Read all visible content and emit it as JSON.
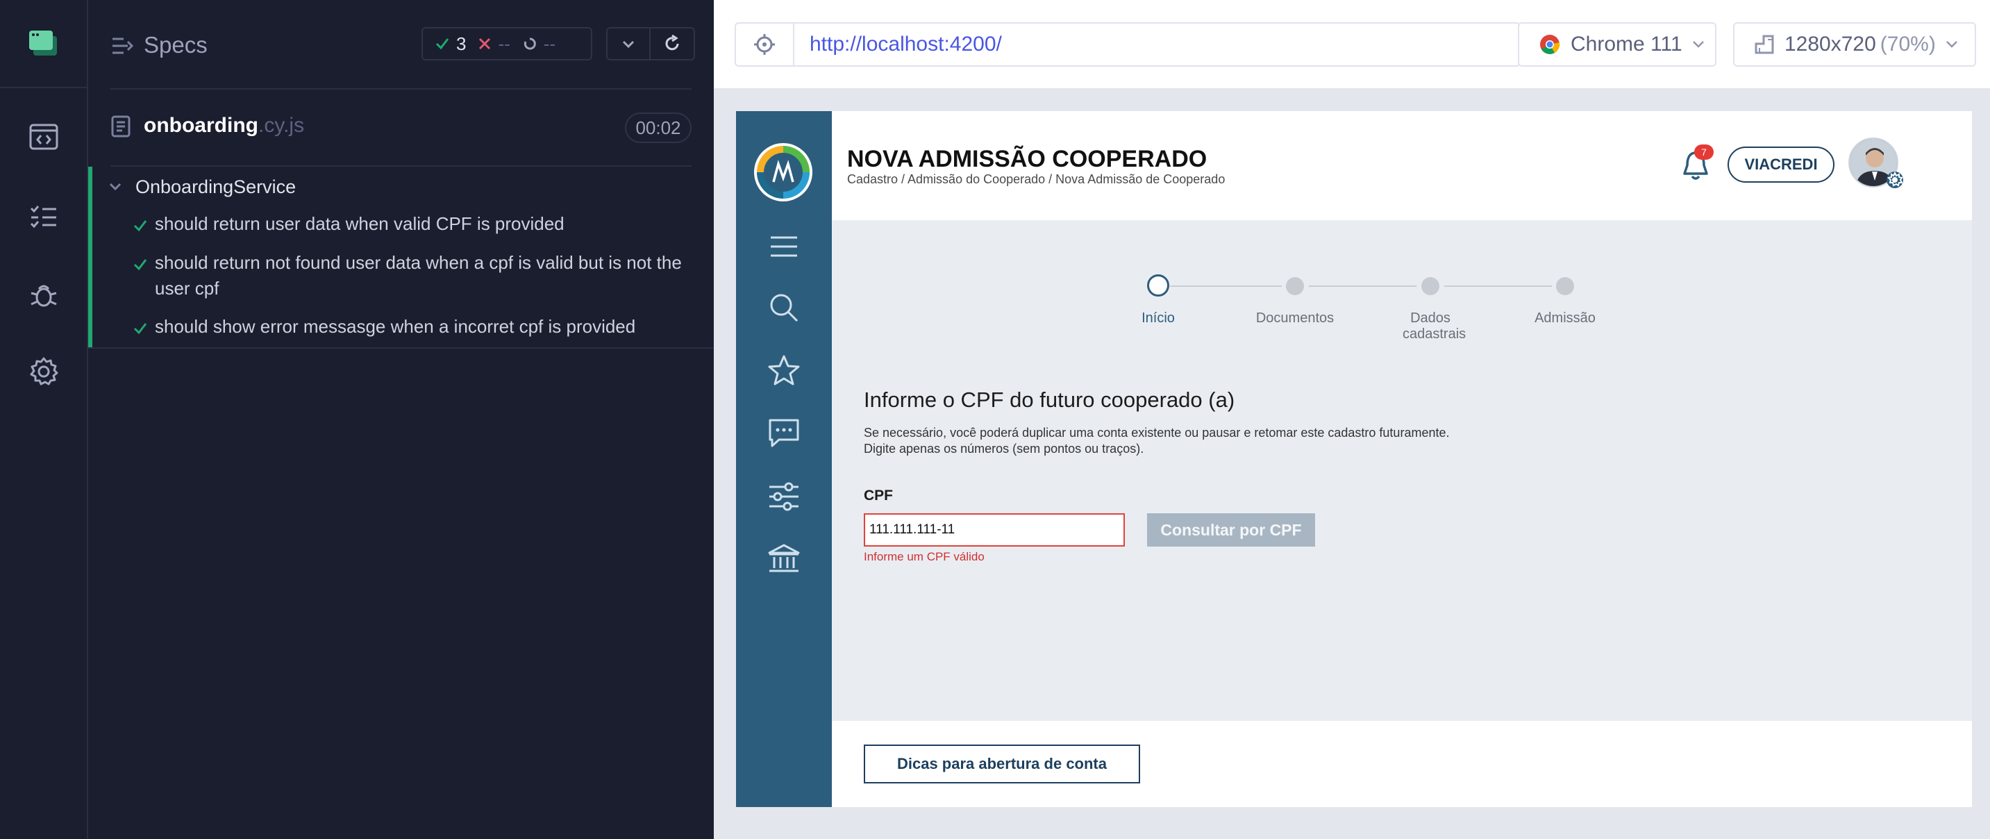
{
  "runner": {
    "specs_title": "Specs",
    "stats": {
      "passed": "3",
      "failed": "--",
      "pending": "--"
    },
    "spec_file": {
      "name": "onboarding",
      "ext": ".cy.js",
      "duration": "00:02"
    },
    "suite": {
      "title": "OnboardingService",
      "tests": [
        {
          "title": "should return user data when valid CPF is provided",
          "state": "passed"
        },
        {
          "title": "should return not found user data when a cpf is valid but is not the user cpf",
          "state": "passed"
        },
        {
          "title": "should show error messasge when a incorret cpf is provided",
          "state": "passed"
        }
      ]
    },
    "colors": {
      "bg": "#1b1e2e",
      "pass": "#1fa971",
      "fail": "#e45770",
      "url": "#4956e3"
    }
  },
  "aut_toolbar": {
    "url": "http://localhost:4200/",
    "browser": "Chrome 111",
    "viewport": "1280x720",
    "zoom": "(70%)"
  },
  "app": {
    "title": "NOVA ADMISSÃO COOPERADO",
    "breadcrumb": "Cadastro / Admissão do Cooperado / Nova Admissão de Cooperado",
    "notifications": "7",
    "coop_button": "VIACREDI",
    "steps": [
      {
        "label": "Início"
      },
      {
        "label": "Documentos"
      },
      {
        "label": "Dados cadastrais"
      },
      {
        "label": "Admissão"
      }
    ],
    "form": {
      "title": "Informe o CPF do futuro cooperado (a)",
      "help_line1": "Se necessário, você poderá duplicar uma conta existente ou pausar e retomar este cadastro futuramente.",
      "help_line2": "Digite apenas os números (sem pontos ou traços).",
      "cpf_label": "CPF",
      "cpf_value": "111.111.111-11",
      "cpf_error": "Informe um CPF válido",
      "consult_button": "Consultar por CPF"
    },
    "tips_button": "Dicas para abertura de conta",
    "colors": {
      "sidebar": "#2d5d7d",
      "primary": "#1d3f5e",
      "error": "#d32f2f"
    }
  }
}
